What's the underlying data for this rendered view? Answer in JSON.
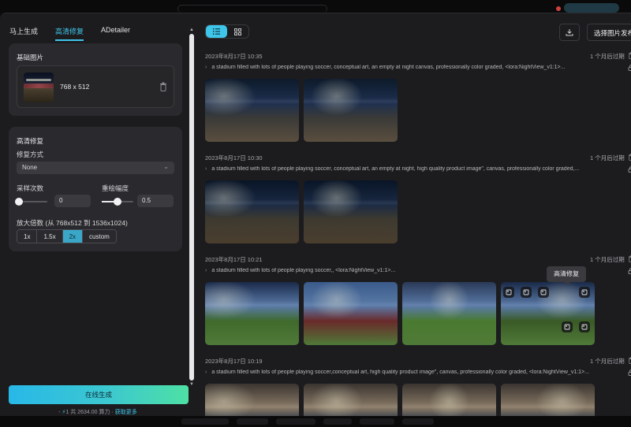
{
  "tabs": [
    "马上生成",
    "高清修复",
    "ADetailer"
  ],
  "active_tab_index": 1,
  "base_image": {
    "title": "基础图片",
    "size": "768 x 512"
  },
  "hires": {
    "title": "高清修复",
    "method_label": "修复方式",
    "method_value": "None",
    "steps_label": "采样次数",
    "steps_value": "0",
    "steps_fraction": 0.0,
    "denoise_label": "重绘幅度",
    "denoise_value": "0.5",
    "denoise_fraction": 0.5,
    "scale_label": "放大倍数 (从 768x512 到 1536x1024)",
    "scale_options": [
      "1x",
      "1.5x",
      "2x",
      "custom"
    ],
    "scale_active_index": 2
  },
  "generate_button": "在线生成",
  "credits": {
    "prefix": "- ",
    "bolt": "⚡",
    "text": "1 共 2634.00 算力 · ",
    "link": "获取更多"
  },
  "toolbar": {
    "publish_label": "选择图片发布"
  },
  "tooltip": "高清修复",
  "groups": [
    {
      "date": "2023年8月17日 10:35",
      "expiry": "1 个月后过期",
      "prompt": "a stadium filled with lots of people playing soccer, conceptual art, an empty at night canvas, professionally color graded, <lora:NightView_v1:1>...",
      "image_count": 2
    },
    {
      "date": "2023年8月17日 10:30",
      "expiry": "1 个月后过期",
      "prompt": "a stadium filled with lots of people playing soccer, conceptual art, an empty at night, high quality product image\", canvas, professionally color graded,...",
      "image_count": 2
    },
    {
      "date": "2023年8月17日 10:21",
      "expiry": "1 个月后过期",
      "prompt": "a stadium filled with lots of people playing soccer,, <lora:NightView_v1:1>...",
      "image_count": 4
    },
    {
      "date": "2023年8月17日 10:19",
      "expiry": "1 个月后过期",
      "prompt": "a stadium filled with lots of people playing soccer,conceptual art, high quality product image\", canvas, professionally color graded, <lora:NightView_v1:1>...",
      "image_count": 4
    }
  ],
  "colors": {
    "accent": "#3ec6ea",
    "panel": "#2a2a2e",
    "background": "#1c1c1f",
    "gradient_start": "#28b8e8",
    "gradient_end": "#4ee0a4"
  },
  "icons": [
    "trash-icon",
    "list-view-icon",
    "grid-view-icon",
    "download-icon",
    "chevron-down-icon",
    "lock-icon",
    "send-icon",
    "hires-fix-icon"
  ]
}
